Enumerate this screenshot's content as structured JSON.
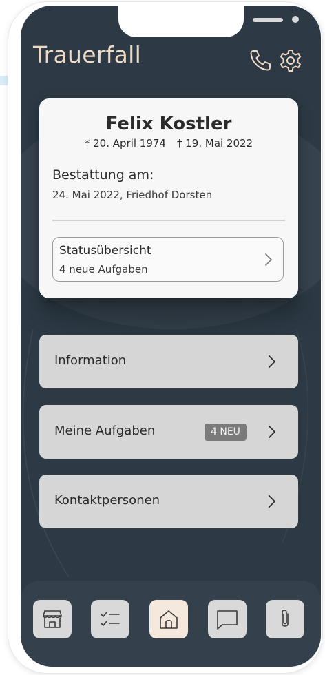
{
  "header": {
    "title": "Trauerfall",
    "phone_icon": "phone-icon",
    "settings_icon": "gear-icon"
  },
  "deceased": {
    "name": "Felix Kostler",
    "birth": "* 20. April 1974",
    "death": "† 19. Mai 2022",
    "burial_label": "Bestattung am:",
    "burial_value": "24. Mai 2022, Friedhof Dorsten"
  },
  "status": {
    "title": "Statusübersicht",
    "subtitle": "4 neue Aufgaben"
  },
  "menu": [
    {
      "label": "Information",
      "badge": ""
    },
    {
      "label": "Meine Aufgaben",
      "badge": "4 NEU"
    },
    {
      "label": "Kontaktpersonen",
      "badge": ""
    }
  ],
  "tabbar": [
    {
      "icon": "store-icon",
      "active": false
    },
    {
      "icon": "checklist-icon",
      "active": false
    },
    {
      "icon": "home-icon",
      "active": true
    },
    {
      "icon": "chat-icon",
      "active": false
    },
    {
      "icon": "paperclip-icon",
      "active": false
    }
  ],
  "colors": {
    "background": "#2d3a45",
    "title_accent": "#efd9c3",
    "card": "#f7f7f7",
    "menu_item": "#d6d6d6",
    "badge": "#7a7a7a",
    "active_tab": "#f5e8dc"
  }
}
